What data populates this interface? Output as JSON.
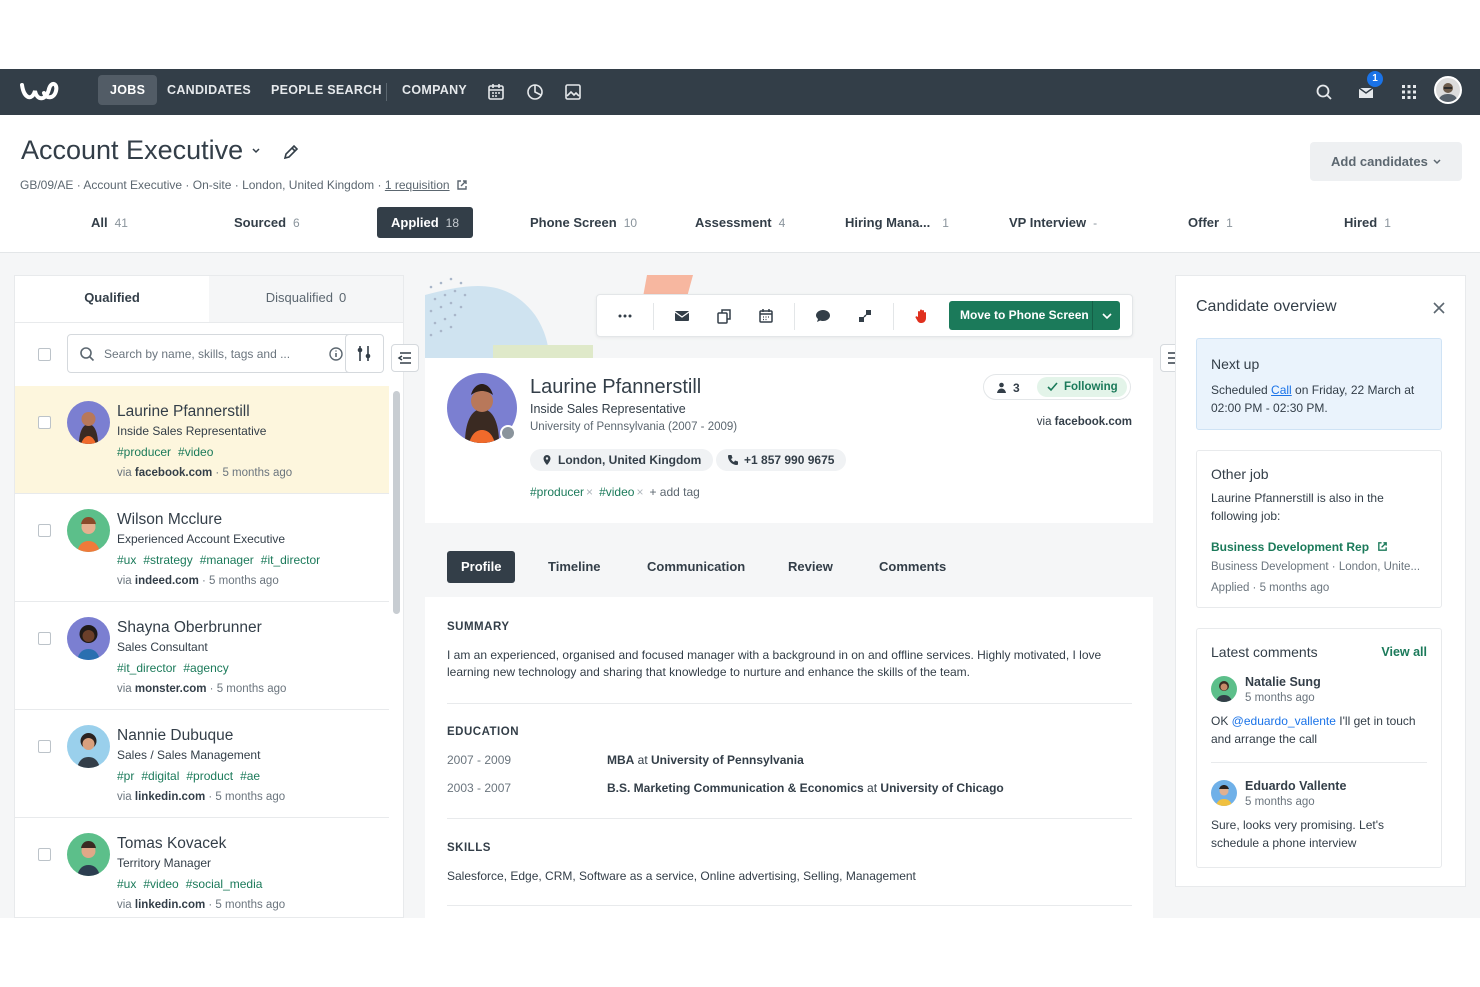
{
  "nav": {
    "items": [
      "JOBS",
      "CANDIDATES",
      "PEOPLE SEARCH",
      "COMPANY"
    ],
    "active": "JOBS",
    "icons": [
      "calendar-icon",
      "pie-chart-icon",
      "image-icon",
      "search-icon",
      "inbox-icon",
      "apps-grid-icon",
      "user-avatar"
    ],
    "notification_count": "1"
  },
  "job": {
    "title": "Account Executive",
    "meta": "GB/09/AE · Account Executive · On-site · London, United Kingdom · ",
    "requisition_link": "1 requisition",
    "add_candidates": "Add candidates"
  },
  "stages": [
    {
      "label": "All",
      "count": "41"
    },
    {
      "label": "Sourced",
      "count": "6"
    },
    {
      "label": "Applied",
      "count": "18"
    },
    {
      "label": "Phone Screen",
      "count": "10"
    },
    {
      "label": "Assessment",
      "count": "4"
    },
    {
      "label": "Hiring Mana...",
      "count": "1"
    },
    {
      "label": "VP Interview",
      "count": "-"
    },
    {
      "label": "Offer",
      "count": "1"
    },
    {
      "label": "Hired",
      "count": "1"
    }
  ],
  "list": {
    "tabs": [
      {
        "label": "Qualified",
        "count": ""
      },
      {
        "label": "Disqualified",
        "count": "0"
      }
    ],
    "search_placeholder": "Search by name, skills, tags and ...",
    "candidates": [
      {
        "name": "Laurine Pfannerstill",
        "role": "Inside Sales Representative",
        "tags": [
          "#producer",
          "#video"
        ],
        "via": "via ",
        "source": "facebook.com",
        "time": " · 5 months ago",
        "avatar_bg": "#7b7fd1"
      },
      {
        "name": "Wilson Mcclure",
        "role": "Experienced Account Executive",
        "tags": [
          "#ux",
          "#strategy",
          "#manager",
          "#it_director"
        ],
        "via": "via ",
        "source": "indeed.com",
        "time": " · 5 months ago",
        "avatar_bg": "#5cbf8a"
      },
      {
        "name": "Shayna Oberbrunner",
        "role": "Sales Consultant",
        "tags": [
          "#it_director",
          "#agency"
        ],
        "via": "via ",
        "source": "monster.com",
        "time": " · 5 months ago",
        "avatar_bg": "#7b7fd1"
      },
      {
        "name": "Nannie Dubuque",
        "role": "Sales / Sales Management",
        "tags": [
          "#pr",
          "#digital",
          "#product",
          "#ae"
        ],
        "via": "via ",
        "source": "linkedin.com",
        "time": " · 5 months ago",
        "avatar_bg": "#9ad0ec"
      },
      {
        "name": "Tomas Kovacek",
        "role": "Territory Manager",
        "tags": [
          "#ux",
          "#video",
          "#social_media"
        ],
        "via": "via ",
        "source": "linkedin.com",
        "time": " · 5 months ago",
        "avatar_bg": "#5cbf8a"
      }
    ]
  },
  "toolbar": {
    "move_label": "Move to Phone Screen",
    "icons": [
      "more-icon",
      "email-icon",
      "copy-icon",
      "calendar-icon",
      "comment-icon",
      "share-icon",
      "disqualify-hand-icon"
    ]
  },
  "candidate": {
    "name": "Laurine Pfannerstill",
    "role": "Inside Sales Representative",
    "education_line": "University of Pennsylvania (2007 - 2009)",
    "location": "London, United Kingdom",
    "phone": "+1 857 990 9675",
    "tags": [
      "#producer",
      "#video"
    ],
    "add_tag": "+ add tag",
    "followers": "3",
    "following_label": "Following",
    "via": "via ",
    "source": "facebook.com"
  },
  "profile": {
    "tabs": [
      "Profile",
      "Timeline",
      "Communication",
      "Review",
      "Comments"
    ],
    "summary_heading": "SUMMARY",
    "summary": "I am an experienced, organised and focused manager with a background in on and offline services. Highly motivated, I love learning new technology and sharing that knowledge to nurture and enhance the skills of the team.",
    "education_heading": "EDUCATION",
    "education": [
      {
        "years": "2007 - 2009",
        "degree": "MBA",
        "at": " at ",
        "school": "University of Pennsylvania"
      },
      {
        "years": "2003 - 2007",
        "degree": "B.S. Marketing Communication & Economics",
        "at": " at ",
        "school": "University of Chicago"
      }
    ],
    "skills_heading": "SKILLS",
    "skills": "Salesforce, Edge, CRM, Software as a service, Online advertising, Selling, Management"
  },
  "overview": {
    "title": "Candidate overview",
    "next_up": {
      "title": "Next up",
      "pre": "Scheduled ",
      "link": "Call",
      "post": " on Friday, 22 March at 02:00 PM - 02:30 PM."
    },
    "other_job": {
      "title": "Other job",
      "text": "Laurine Pfannerstill is also in the following job:",
      "job": "Business Development Rep",
      "dept": "Business Development · London, Unite...",
      "status": "Applied · 5 months ago"
    },
    "comments": {
      "title": "Latest comments",
      "view_all": "View all",
      "items": [
        {
          "author": "Natalie Sung",
          "time": "5 months ago",
          "pre": "OK ",
          "mention": "@eduardo_vallente",
          "text": " I'll get in touch and arrange the call"
        },
        {
          "author": "Eduardo Vallente",
          "time": "5 months ago",
          "pre": "",
          "mention": "",
          "text": "Sure, looks very promising. Let's schedule a phone interview"
        }
      ]
    }
  }
}
